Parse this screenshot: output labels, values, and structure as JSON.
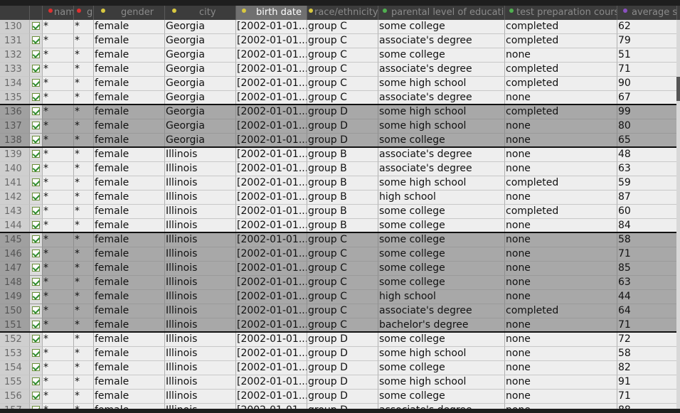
{
  "table": {
    "columns": [
      {
        "label": "name",
        "dot": "#e03030"
      },
      {
        "label": "gen",
        "dot": "#e03030"
      },
      {
        "label": "gender",
        "dot": "#d8c840"
      },
      {
        "label": "city",
        "dot": "#d8c840"
      },
      {
        "label": "birth date",
        "dot": "#d8c840"
      },
      {
        "label": "race/ethnicity",
        "dot": "#d8c840"
      },
      {
        "label": "parental level of education",
        "dot": "#50b050"
      },
      {
        "label": "test preparation course",
        "dot": "#50b050"
      },
      {
        "label": "average score",
        "dot": "#8a50c0"
      }
    ],
    "rows": [
      {
        "n": "130",
        "c1": "*",
        "c2": "*",
        "gender": "female",
        "city": "Georgia",
        "bd": "[2002-01-01...",
        "race": "group C",
        "edu": "some college",
        "prep": "completed",
        "score": "62"
      },
      {
        "n": "131",
        "c1": "*",
        "c2": "*",
        "gender": "female",
        "city": "Georgia",
        "bd": "[2002-01-01...",
        "race": "group C",
        "edu": "associate's degree",
        "prep": "completed",
        "score": "79"
      },
      {
        "n": "132",
        "c1": "*",
        "c2": "*",
        "gender": "female",
        "city": "Georgia",
        "bd": "[2002-01-01...",
        "race": "group C",
        "edu": "some college",
        "prep": "none",
        "score": "51"
      },
      {
        "n": "133",
        "c1": "*",
        "c2": "*",
        "gender": "female",
        "city": "Georgia",
        "bd": "[2002-01-01...",
        "race": "group C",
        "edu": "associate's degree",
        "prep": "completed",
        "score": "71"
      },
      {
        "n": "134",
        "c1": "*",
        "c2": "*",
        "gender": "female",
        "city": "Georgia",
        "bd": "[2002-01-01...",
        "race": "group C",
        "edu": "some high school",
        "prep": "completed",
        "score": "90"
      },
      {
        "n": "135",
        "c1": "*",
        "c2": "*",
        "gender": "female",
        "city": "Georgia",
        "bd": "[2002-01-01...",
        "race": "group C",
        "edu": "associate's degree",
        "prep": "none",
        "score": "67"
      },
      {
        "n": "136",
        "c1": "*",
        "c2": "*",
        "gender": "female",
        "city": "Georgia",
        "bd": "[2002-01-01...",
        "race": "group D",
        "edu": "some high school",
        "prep": "completed",
        "score": "99",
        "sel": true,
        "gtop": true
      },
      {
        "n": "137",
        "c1": "*",
        "c2": "*",
        "gender": "female",
        "city": "Georgia",
        "bd": "[2002-01-01...",
        "race": "group D",
        "edu": "some high school",
        "prep": "none",
        "score": "80",
        "sel": true
      },
      {
        "n": "138",
        "c1": "*",
        "c2": "*",
        "gender": "female",
        "city": "Georgia",
        "bd": "[2002-01-01...",
        "race": "group D",
        "edu": "some college",
        "prep": "none",
        "score": "65",
        "sel": true
      },
      {
        "n": "139",
        "c1": "*",
        "c2": "*",
        "gender": "female",
        "city": "Illinois",
        "bd": "[2002-01-01...",
        "race": "group B",
        "edu": "associate's degree",
        "prep": "none",
        "score": "48",
        "gtop": true
      },
      {
        "n": "140",
        "c1": "*",
        "c2": "*",
        "gender": "female",
        "city": "Illinois",
        "bd": "[2002-01-01...",
        "race": "group B",
        "edu": "associate's degree",
        "prep": "none",
        "score": "63"
      },
      {
        "n": "141",
        "c1": "*",
        "c2": "*",
        "gender": "female",
        "city": "Illinois",
        "bd": "[2002-01-01...",
        "race": "group B",
        "edu": "some high school",
        "prep": "completed",
        "score": "59"
      },
      {
        "n": "142",
        "c1": "*",
        "c2": "*",
        "gender": "female",
        "city": "Illinois",
        "bd": "[2002-01-01...",
        "race": "group B",
        "edu": "high school",
        "prep": "none",
        "score": "87"
      },
      {
        "n": "143",
        "c1": "*",
        "c2": "*",
        "gender": "female",
        "city": "Illinois",
        "bd": "[2002-01-01...",
        "race": "group B",
        "edu": "some college",
        "prep": "completed",
        "score": "60"
      },
      {
        "n": "144",
        "c1": "*",
        "c2": "*",
        "gender": "female",
        "city": "Illinois",
        "bd": "[2002-01-01...",
        "race": "group B",
        "edu": "some college",
        "prep": "none",
        "score": "84"
      },
      {
        "n": "145",
        "c1": "*",
        "c2": "*",
        "gender": "female",
        "city": "Illinois",
        "bd": "[2002-01-01...",
        "race": "group C",
        "edu": "some college",
        "prep": "none",
        "score": "58",
        "sel": true,
        "gtop": true
      },
      {
        "n": "146",
        "c1": "*",
        "c2": "*",
        "gender": "female",
        "city": "Illinois",
        "bd": "[2002-01-01...",
        "race": "group C",
        "edu": "some college",
        "prep": "none",
        "score": "71",
        "sel": true
      },
      {
        "n": "147",
        "c1": "*",
        "c2": "*",
        "gender": "female",
        "city": "Illinois",
        "bd": "[2002-01-01...",
        "race": "group C",
        "edu": "some college",
        "prep": "none",
        "score": "85",
        "sel": true
      },
      {
        "n": "148",
        "c1": "*",
        "c2": "*",
        "gender": "female",
        "city": "Illinois",
        "bd": "[2002-01-01...",
        "race": "group C",
        "edu": "some college",
        "prep": "none",
        "score": "63",
        "sel": true
      },
      {
        "n": "149",
        "c1": "*",
        "c2": "*",
        "gender": "female",
        "city": "Illinois",
        "bd": "[2002-01-01...",
        "race": "group C",
        "edu": "high school",
        "prep": "none",
        "score": "44",
        "sel": true
      },
      {
        "n": "150",
        "c1": "*",
        "c2": "*",
        "gender": "female",
        "city": "Illinois",
        "bd": "[2002-01-01...",
        "race": "group C",
        "edu": "associate's degree",
        "prep": "completed",
        "score": "64",
        "sel": true
      },
      {
        "n": "151",
        "c1": "*",
        "c2": "*",
        "gender": "female",
        "city": "Illinois",
        "bd": "[2002-01-01...",
        "race": "group C",
        "edu": "bachelor's degree",
        "prep": "none",
        "score": "71",
        "sel": true
      },
      {
        "n": "152",
        "c1": "*",
        "c2": "*",
        "gender": "female",
        "city": "Illinois",
        "bd": "[2002-01-01...",
        "race": "group D",
        "edu": "some college",
        "prep": "none",
        "score": "72",
        "gtop": true
      },
      {
        "n": "153",
        "c1": "*",
        "c2": "*",
        "gender": "female",
        "city": "Illinois",
        "bd": "[2002-01-01...",
        "race": "group D",
        "edu": "some high school",
        "prep": "none",
        "score": "58"
      },
      {
        "n": "154",
        "c1": "*",
        "c2": "*",
        "gender": "female",
        "city": "Illinois",
        "bd": "[2002-01-01...",
        "race": "group D",
        "edu": "some college",
        "prep": "none",
        "score": "82"
      },
      {
        "n": "155",
        "c1": "*",
        "c2": "*",
        "gender": "female",
        "city": "Illinois",
        "bd": "[2002-01-01...",
        "race": "group D",
        "edu": "some high school",
        "prep": "none",
        "score": "91"
      },
      {
        "n": "156",
        "c1": "*",
        "c2": "*",
        "gender": "female",
        "city": "Illinois",
        "bd": "[2002-01-01...",
        "race": "group D",
        "edu": "some college",
        "prep": "none",
        "score": "71"
      },
      {
        "n": "157",
        "c1": "*",
        "c2": "*",
        "gender": "female",
        "city": "Illinois",
        "bd": "[2002-01-01...",
        "race": "group D",
        "edu": "associate's degree",
        "prep": "none",
        "score": "88"
      }
    ]
  }
}
